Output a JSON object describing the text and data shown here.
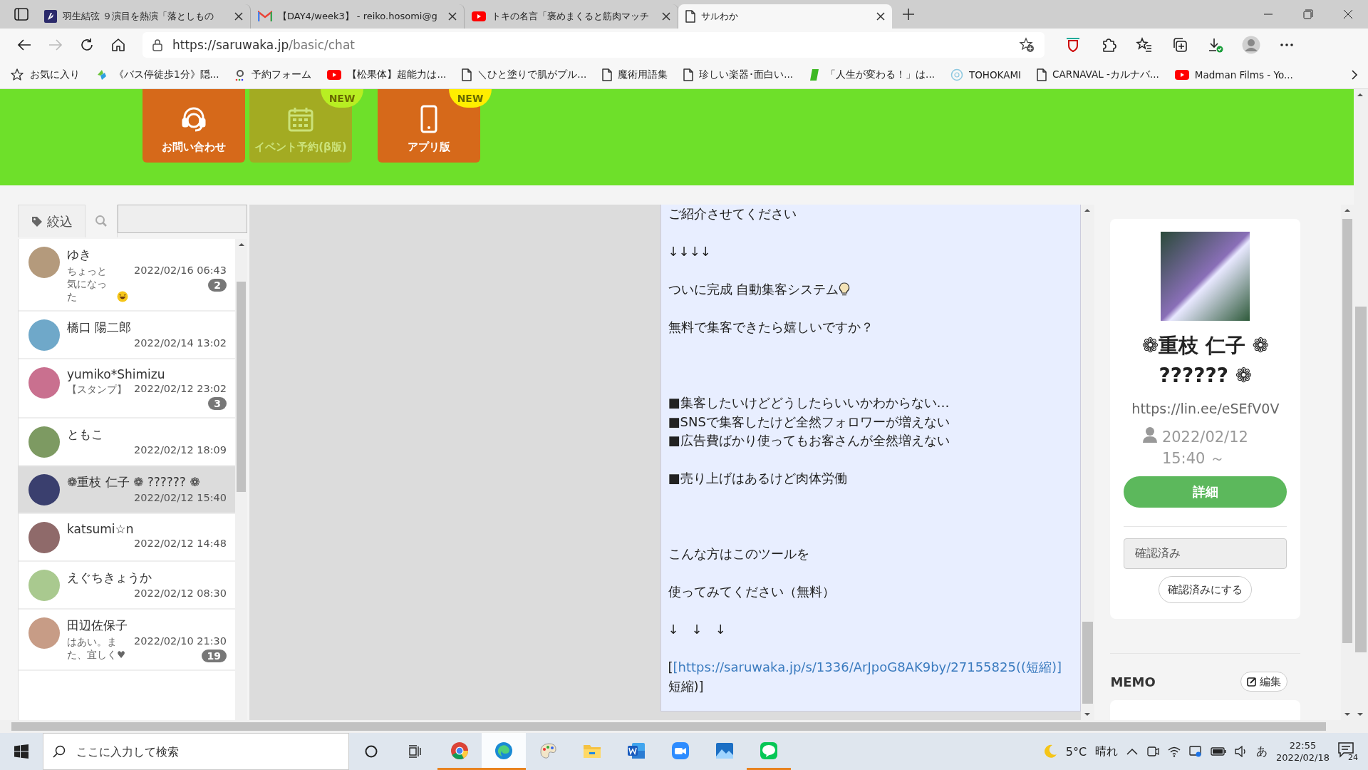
{
  "browser": {
    "tabs": [
      {
        "title": "羽生結弦 ９演目を熱演「落としもの",
        "kind": "letter",
        "selected": false
      },
      {
        "title": "【DAY4/week3】 - reiko.hosomi@g",
        "kind": "mail",
        "selected": false
      },
      {
        "title": "トキの名言「褒めまくると筋肉マッチ",
        "kind": "video",
        "selected": false
      },
      {
        "title": "サルわか",
        "kind": "page",
        "selected": true
      }
    ],
    "address": {
      "host": "https://saruwaka.jp",
      "path": "/basic/chat"
    },
    "bookmarks": [
      {
        "label": "お気に入り",
        "kind": "star"
      },
      {
        "label": "《バス停徒歩1分》隠...",
        "kind": "leaf"
      },
      {
        "label": "予約フォーム",
        "kind": "letter_a"
      },
      {
        "label": "【松果体】超能力は...",
        "kind": "video"
      },
      {
        "label": "＼ひと塗りで肌がプル...",
        "kind": "page"
      },
      {
        "label": "魔術用語集",
        "kind": "page"
      },
      {
        "label": "珍しい楽器･面白い...",
        "kind": "page"
      },
      {
        "label": "「人生が変わる！」は...",
        "kind": "b"
      },
      {
        "label": "TOHOKAMI",
        "kind": "flower"
      },
      {
        "label": "CARNAVAL -カルナバ...",
        "kind": "page"
      },
      {
        "label": "Madman Films - Yo...",
        "kind": "video"
      }
    ]
  },
  "header": {
    "buttons": [
      {
        "label": "お問い合わせ",
        "kind": "headset",
        "disabled": false
      },
      {
        "label": "イベント予約(β版)",
        "kind": "calendar",
        "disabled": true,
        "badge": "NEW",
        "color": "#b8ee22"
      },
      {
        "label": "アプリ版",
        "kind": "phone",
        "disabled": false,
        "badge": "NEW",
        "color": "#ffee00"
      }
    ]
  },
  "sidebar": {
    "filter": {
      "label": "絞込"
    },
    "conversations": [
      {
        "kind": "emoji_preview",
        "name": "ゆき",
        "time": "2022/02/16 06:43",
        "preview": "ちょっと気になった",
        "unread": "2",
        "selected": false
      },
      {
        "name": "橋口 陽二郎",
        "time": "2022/02/14 13:02",
        "selected": false
      },
      {
        "name": "yumiko*Shimizu",
        "time": "2022/02/12 23:02",
        "preview": "【スタンプ】",
        "unread": "3",
        "selected": false
      },
      {
        "name": "ともこ",
        "time": "2022/02/12 18:09",
        "selected": false
      },
      {
        "name": "❁重枝 仁子 ❁ ?????? ❁",
        "time": "2022/02/12 15:40",
        "selected": true
      },
      {
        "name": "katsumi☆n",
        "time": "2022/02/12 14:48",
        "selected": false
      },
      {
        "name": "えぐちきょうか",
        "time": "2022/02/12 08:30",
        "selected": false
      },
      {
        "name": "田辺佐保子",
        "time": "2022/02/10 21:30",
        "preview": "はあい。また、宜しく♥",
        "unread": "19",
        "selected": false
      }
    ]
  },
  "chat": {
    "lines": [
      {
        "kind": "text",
        "text": "ご紹介させてください"
      },
      {
        "kind": "blank"
      },
      {
        "kind": "text",
        "text": "↓↓↓↓"
      },
      {
        "kind": "blank"
      },
      {
        "kind": "text_bulb",
        "text": "ついに完成 自動集客システム"
      },
      {
        "kind": "blank"
      },
      {
        "kind": "text",
        "text": "無料で集客できたら嬉しいですか？"
      },
      {
        "kind": "blank"
      },
      {
        "kind": "blank"
      },
      {
        "kind": "blank"
      },
      {
        "kind": "text",
        "text": "■集客したいけどどうしたらいいかわからない…"
      },
      {
        "kind": "text",
        "text": "■SNSで集客したけど全然フォロワーが増えない"
      },
      {
        "kind": "text",
        "text": "■広告費ばかり使ってもお客さんが全然増えない"
      },
      {
        "kind": "blank"
      },
      {
        "kind": "text",
        "text": "■売り上げはあるけど肉体労働"
      },
      {
        "kind": "blank"
      },
      {
        "kind": "blank"
      },
      {
        "kind": "blank"
      },
      {
        "kind": "text",
        "text": "こんな方はこのツールを"
      },
      {
        "kind": "blank"
      },
      {
        "kind": "text",
        "text": "使ってみてください（無料）"
      },
      {
        "kind": "blank"
      },
      {
        "kind": "text",
        "text": "↓　↓　↓"
      },
      {
        "kind": "blank"
      },
      {
        "kind": "link",
        "before": "[",
        "link": "[https://saruwaka.jp/s/1336/ArJpoG8AK9by/27155825((短縮)]",
        "after": "短縮)]"
      }
    ]
  },
  "profile": {
    "name": "❁重枝 仁子 ❁ ?????? ❁",
    "url": "https://lin.ee/eSEfV0V",
    "since": "2022/02/12 15:40 ～",
    "detail_button": "詳細",
    "status_value": "確認済み",
    "status_button": "確認済みにする",
    "memo_title": "MEMO",
    "memo_edit": "編集"
  },
  "taskbar": {
    "search_placeholder": "ここに入力して検索",
    "apps": [
      {
        "kind": "chrome",
        "running": true,
        "selected": false
      },
      {
        "kind": "edge",
        "running": true,
        "selected": true
      },
      {
        "kind": "paint",
        "running": false,
        "selected": false
      },
      {
        "kind": "explorer",
        "running": false,
        "selected": false
      },
      {
        "kind": "word",
        "running": false,
        "selected": false
      },
      {
        "kind": "zoom",
        "running": false,
        "selected": false
      },
      {
        "kind": "photos",
        "running": false,
        "selected": false
      },
      {
        "kind": "line",
        "running": true,
        "selected": false
      }
    ],
    "temperature": "5°C",
    "weather": "晴れ",
    "ime": "あ",
    "time": "22:55",
    "date": "2022/02/18",
    "notifications": "24"
  }
}
